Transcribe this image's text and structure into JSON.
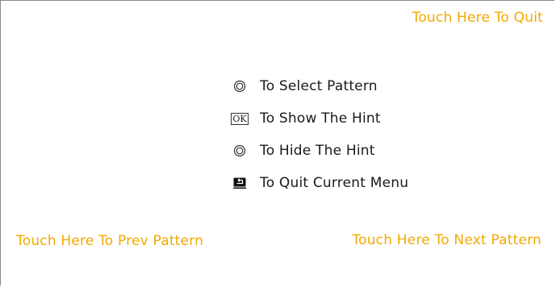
{
  "screen": {
    "quit_hint": "Touch Here To Quit",
    "prev_hint": "Touch Here To Prev Pattern",
    "next_hint": "Touch Here To Next Pattern"
  },
  "legend": {
    "items": [
      {
        "icon": "double-circle-icon",
        "label": "To Select Pattern"
      },
      {
        "icon": "ok-key-icon",
        "icon_text": "OK",
        "label": "To Show The Hint"
      },
      {
        "icon": "double-circle-icon",
        "label": "To Hide The Hint"
      },
      {
        "icon": "return-arrow-icon",
        "label": "To Quit Current Menu"
      }
    ]
  },
  "colors": {
    "accent": "#f2a900",
    "text": "#1a1a1a",
    "border": "#8a8a8a"
  }
}
